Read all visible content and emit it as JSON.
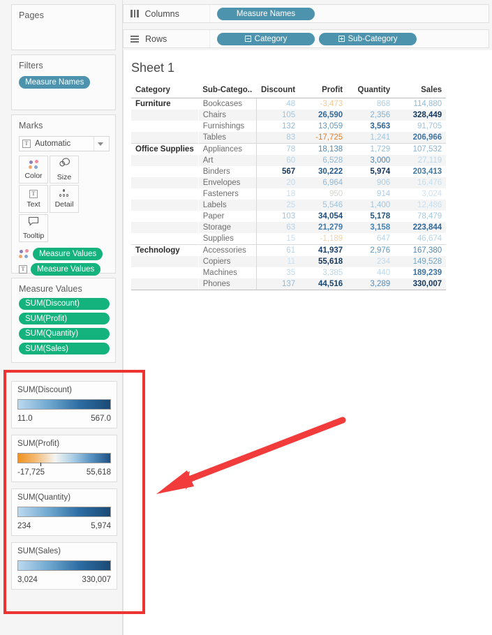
{
  "shelves": {
    "pages": {
      "title": "Pages"
    },
    "filters": {
      "title": "Filters",
      "pills": [
        "Measure Names"
      ]
    },
    "marks": {
      "title": "Marks",
      "mark_type": "Automatic",
      "buttons": [
        "Color",
        "Size",
        "Text",
        "Detail",
        "Tooltip"
      ],
      "icons": [
        "color-dots-icon",
        "size-circles-icon",
        "text-t-icon",
        "detail-dots-icon",
        "tooltip-bubble-icon"
      ],
      "pills": [
        "Measure Values",
        "Measure Values"
      ]
    },
    "measure_values": {
      "title": "Measure Values",
      "pills": [
        "SUM(Discount)",
        "SUM(Profit)",
        "SUM(Quantity)",
        "SUM(Sales)"
      ]
    },
    "columns": {
      "label": "Columns",
      "pills": [
        "Measure Names"
      ]
    },
    "rows": {
      "label": "Rows",
      "pills": [
        "Category",
        "Sub-Category"
      ]
    }
  },
  "legends": [
    {
      "title": "SUM(Discount)",
      "min": "11.0",
      "max": "567.0",
      "type": "sequential",
      "colors": [
        "#bcd9ee",
        "#6fa8d0",
        "#2d6ca2",
        "#1b4a75"
      ]
    },
    {
      "title": "SUM(Profit)",
      "min": "-17,725",
      "max": "55,618",
      "type": "diverging",
      "colors": [
        "#f0921f",
        "#f4bd7a",
        "#f4f4f2",
        "#a8cde6",
        "#5590c0",
        "#1e5183"
      ],
      "tick_pct": 24
    },
    {
      "title": "SUM(Quantity)",
      "min": "234",
      "max": "5,974",
      "type": "sequential",
      "colors": [
        "#bcd9ee",
        "#6fa8d0",
        "#2d6ca2",
        "#1b4a75"
      ]
    },
    {
      "title": "SUM(Sales)",
      "min": "3,024",
      "max": "330,007",
      "type": "sequential",
      "colors": [
        "#bcd9ee",
        "#6fa8d0",
        "#2d6ca2",
        "#1b4a75"
      ]
    }
  ],
  "worksheet": {
    "title": "Sheet 1",
    "columns": [
      "Category",
      "Sub-Catego..",
      "Discount",
      "Profit",
      "Quantity",
      "Sales"
    ],
    "rows": [
      {
        "category": "Furniture",
        "sub": "Bookcases",
        "discount": "48",
        "profit": "-3,473",
        "quantity": "868",
        "sales": "114,880",
        "c_discount": "#a9cfe8",
        "c_profit": "#f5c992",
        "c_quantity": "#a9cfe8",
        "c_sales": "#8fbcda",
        "group_start": true
      },
      {
        "category": "",
        "sub": "Chairs",
        "discount": "105",
        "profit": "26,590",
        "quantity": "2,356",
        "sales": "328,449",
        "c_discount": "#9cc6e3",
        "c_profit": "#31699e",
        "c_quantity": "#7fb1d3",
        "c_sales": "#12365c",
        "band": true
      },
      {
        "category": "",
        "sub": "Furnishings",
        "discount": "132",
        "profit": "13,059",
        "quantity": "3,563",
        "sales": "91,705",
        "c_discount": "#8dbcdd",
        "c_profit": "#5f9cc7",
        "c_quantity": "#2e679c",
        "c_sales": "#9cc6e3"
      },
      {
        "category": "",
        "sub": "Tables",
        "discount": "83",
        "profit": "-17,725",
        "quantity": "1,241",
        "sales": "206,966",
        "c_discount": "#a3cae5",
        "c_profit": "#ea7b1c",
        "c_quantity": "#9cc6e3",
        "c_sales": "#3d76a7",
        "band": true
      },
      {
        "category": "Office Supplies",
        "sub": "Appliances",
        "discount": "78",
        "profit": "18,138",
        "quantity": "1,729",
        "sales": "107,532",
        "c_discount": "#a6cce6",
        "c_profit": "#4d8cbc",
        "c_quantity": "#93c0e0",
        "c_sales": "#83b5d6",
        "group_start": true
      },
      {
        "category": "",
        "sub": "Art",
        "discount": "60",
        "profit": "6,528",
        "quantity": "3,000",
        "sales": "27,119",
        "c_discount": "#b2d4ea",
        "c_profit": "#8cbbdd",
        "c_quantity": "#4a89ba",
        "c_sales": "#b8d8ec",
        "band": true
      },
      {
        "category": "",
        "sub": "Binders",
        "discount": "567",
        "profit": "30,222",
        "quantity": "5,974",
        "sales": "203,413",
        "c_discount": "#12365c",
        "c_profit": "#245b91",
        "c_quantity": "#12365c",
        "c_sales": "#40789f"
      },
      {
        "category": "",
        "sub": "Envelopes",
        "discount": "20",
        "profit": "6,964",
        "quantity": "906",
        "sales": "16,476",
        "c_discount": "#bedcee",
        "c_profit": "#8abadc",
        "c_quantity": "#a9cfe8",
        "c_sales": "#c3dff0",
        "band": true
      },
      {
        "category": "",
        "sub": "Fasteners",
        "discount": "18",
        "profit": "950",
        "quantity": "914",
        "sales": "3,024",
        "c_discount": "#c2deef",
        "c_profit": "#d5d5d0",
        "c_quantity": "#a9cfe8",
        "c_sales": "#cbe3f2"
      },
      {
        "category": "",
        "sub": "Labels",
        "discount": "25",
        "profit": "5,546",
        "quantity": "1,400",
        "sales": "12,486",
        "c_discount": "#bddbee",
        "c_profit": "#98c3e0",
        "c_quantity": "#9cc6e3",
        "c_sales": "#c5e0f1",
        "band": true
      },
      {
        "category": "",
        "sub": "Paper",
        "discount": "103",
        "profit": "34,054",
        "quantity": "5,178",
        "sales": "78,479",
        "c_discount": "#9cc6e3",
        "c_profit": "#1d4f81",
        "c_quantity": "#1f5586",
        "c_sales": "#a3cae5"
      },
      {
        "category": "",
        "sub": "Storage",
        "discount": "63",
        "profit": "21,279",
        "quantity": "3,158",
        "sales": "223,844",
        "c_discount": "#b0d3e9",
        "c_profit": "#3f7cae",
        "c_quantity": "#4285b7",
        "c_sales": "#2e679c",
        "band": true
      },
      {
        "category": "",
        "sub": "Supplies",
        "discount": "15",
        "profit": "-1,189",
        "quantity": "647",
        "sales": "46,674",
        "c_discount": "#c6e0f1",
        "c_profit": "#f3d2a8",
        "c_quantity": "#b5d6eb",
        "c_sales": "#b0d3e9"
      },
      {
        "category": "Technology",
        "sub": "Accessories",
        "discount": "61",
        "profit": "41,937",
        "quantity": "2,976",
        "sales": "167,380",
        "c_discount": "#b0d3e9",
        "c_profit": "#17416c",
        "c_quantity": "#5b97c3",
        "c_sales": "#4f89b5",
        "group_start": true
      },
      {
        "category": "",
        "sub": "Copiers",
        "discount": "11",
        "profit": "55,618",
        "quantity": "234",
        "sales": "149,528",
        "c_discount": "#c8e1f2",
        "c_profit": "#12365c",
        "c_quantity": "#bedcee",
        "c_sales": "#6ba4cb",
        "band": true
      },
      {
        "category": "",
        "sub": "Machines",
        "discount": "35",
        "profit": "3,385",
        "quantity": "440",
        "sales": "189,239",
        "c_discount": "#bddbee",
        "c_profit": "#b9d6ea",
        "c_quantity": "#bcd9ee",
        "c_sales": "#3b74a5"
      },
      {
        "category": "",
        "sub": "Phones",
        "discount": "137",
        "profit": "44,516",
        "quantity": "3,289",
        "sales": "330,007",
        "c_discount": "#8dbcdd",
        "c_profit": "#174670",
        "c_quantity": "#4f8dbe",
        "c_sales": "#12365c",
        "band": true,
        "last": true
      }
    ]
  },
  "annotations": {
    "highlight_color": "#ee3333",
    "arrow_color": "#f23b3b"
  }
}
